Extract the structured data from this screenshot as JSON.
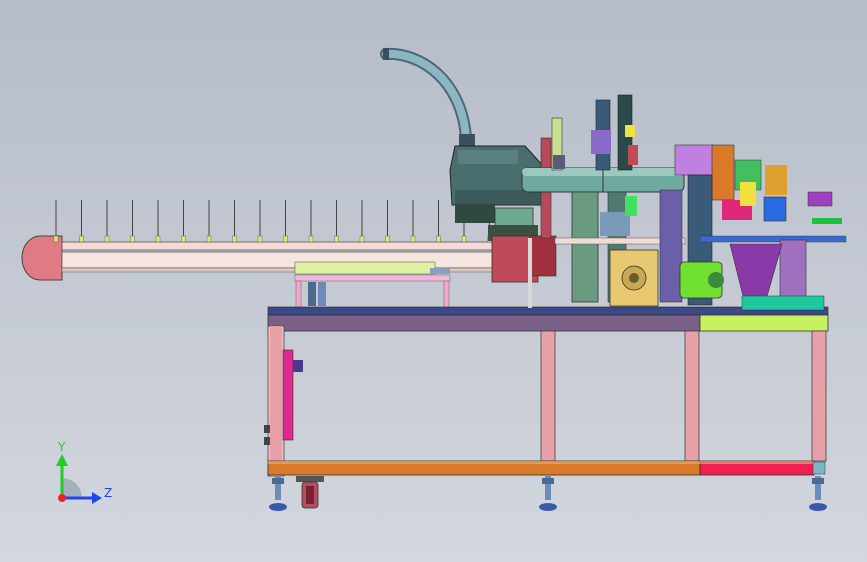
{
  "viewport": {
    "background_top": "#b6bcc8",
    "background_bottom": "#d3d7de"
  },
  "axes_triad": {
    "y_label": "Y",
    "z_label": "Z",
    "y_color": "#22cc22",
    "z_color": "#2244ee",
    "x_color": "#ee2222",
    "icon": "coordinate-triad-icon"
  },
  "model": {
    "icon": "assembly-machine-model",
    "colors": {
      "frame_main": "#e8a0a8",
      "frame_top": "#7a5f86",
      "frame_top_right": "#c8f060",
      "base_beam": "#d87a2a",
      "base_beam_right": "#f02050",
      "conveyor": "#f0dcd6",
      "conveyor_cap": "#e07a84",
      "robot": "#4a6e6e",
      "hose": "#78a4b0",
      "rotary_table": "#6eaaa0",
      "motor": "#c04a58",
      "magenta_panel": "#e02890"
    }
  }
}
